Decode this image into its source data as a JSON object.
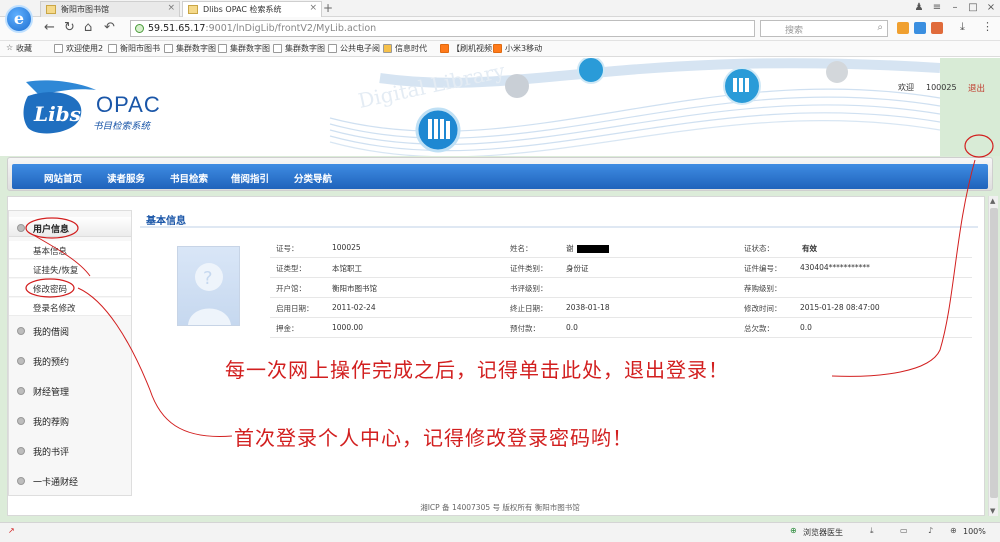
{
  "browser": {
    "tabs": [
      {
        "title": "衡阳市图书馆"
      },
      {
        "title": "Dlibs OPAC 检索系统"
      }
    ],
    "url_host": "59.51.65.17",
    "url_rest": ":9001/lnDigLib/frontV2/MyLib.action",
    "search_placeholder": "搜索",
    "favorites_label": "收藏",
    "favorites": [
      "欢迎使用2",
      "衡阳市图书",
      "集群数字图",
      "集群数字图",
      "集群数字图",
      "公共电子阅",
      "信息时代",
      "【刷机视频",
      "小米3移动"
    ],
    "zoom": "100%",
    "status_doctor": "浏览器医生"
  },
  "site": {
    "brand": "OPAC",
    "logo_text": "Libs",
    "subtitle": "书目检索系统",
    "welcome_label": "欢迎",
    "welcome_id": "100025",
    "logout": "退出",
    "nav": [
      "网站首页",
      "读者服务",
      "书目检索",
      "借阅指引",
      "分类导航"
    ]
  },
  "sidebar": {
    "groups": [
      {
        "label": "用户信息",
        "items": [
          "基本信息",
          "证挂失/恢复",
          "修改密码",
          "登录名修改"
        ]
      },
      {
        "label": "我的借阅"
      },
      {
        "label": "我的预约"
      },
      {
        "label": "财经管理"
      },
      {
        "label": "我的荐购"
      },
      {
        "label": "我的书评"
      },
      {
        "label": "一卡通财经"
      }
    ]
  },
  "info": {
    "title": "基本信息",
    "rows": [
      [
        {
          "label": "证号：",
          "value": "100025"
        },
        {
          "label": "姓名：",
          "value": "谢"
        },
        {
          "label": "证状态：",
          "value": "有效"
        }
      ],
      [
        {
          "label": "证类型：",
          "value": "本馆职工"
        },
        {
          "label": "证件类别：",
          "value": "身份证"
        },
        {
          "label": "证件编号：",
          "value": "430404***********"
        }
      ],
      [
        {
          "label": "开户馆：",
          "value": "衡阳市图书馆"
        },
        {
          "label": "书评级别：",
          "value": ""
        },
        {
          "label": "荐购级别：",
          "value": ""
        }
      ],
      [
        {
          "label": "启用日期：",
          "value": "2011-02-24"
        },
        {
          "label": "终止日期：",
          "value": "2038-01-18"
        },
        {
          "label": "修改时间：",
          "value": "2015-01-28 08:47:00"
        }
      ],
      [
        {
          "label": "押金：",
          "value": "1000.00"
        },
        {
          "label": "预付款：",
          "value": "0.0"
        },
        {
          "label": "总欠款：",
          "value": "0.0"
        }
      ]
    ]
  },
  "footer": "湘ICP 备 14007305 号 版权所有 衡阳市图书馆",
  "annotations": {
    "logout_tip": "每一次网上操作完成之后，记得单击此处，退出登录！",
    "password_tip": "首次登录个人中心，记得修改登录密码哟！"
  }
}
